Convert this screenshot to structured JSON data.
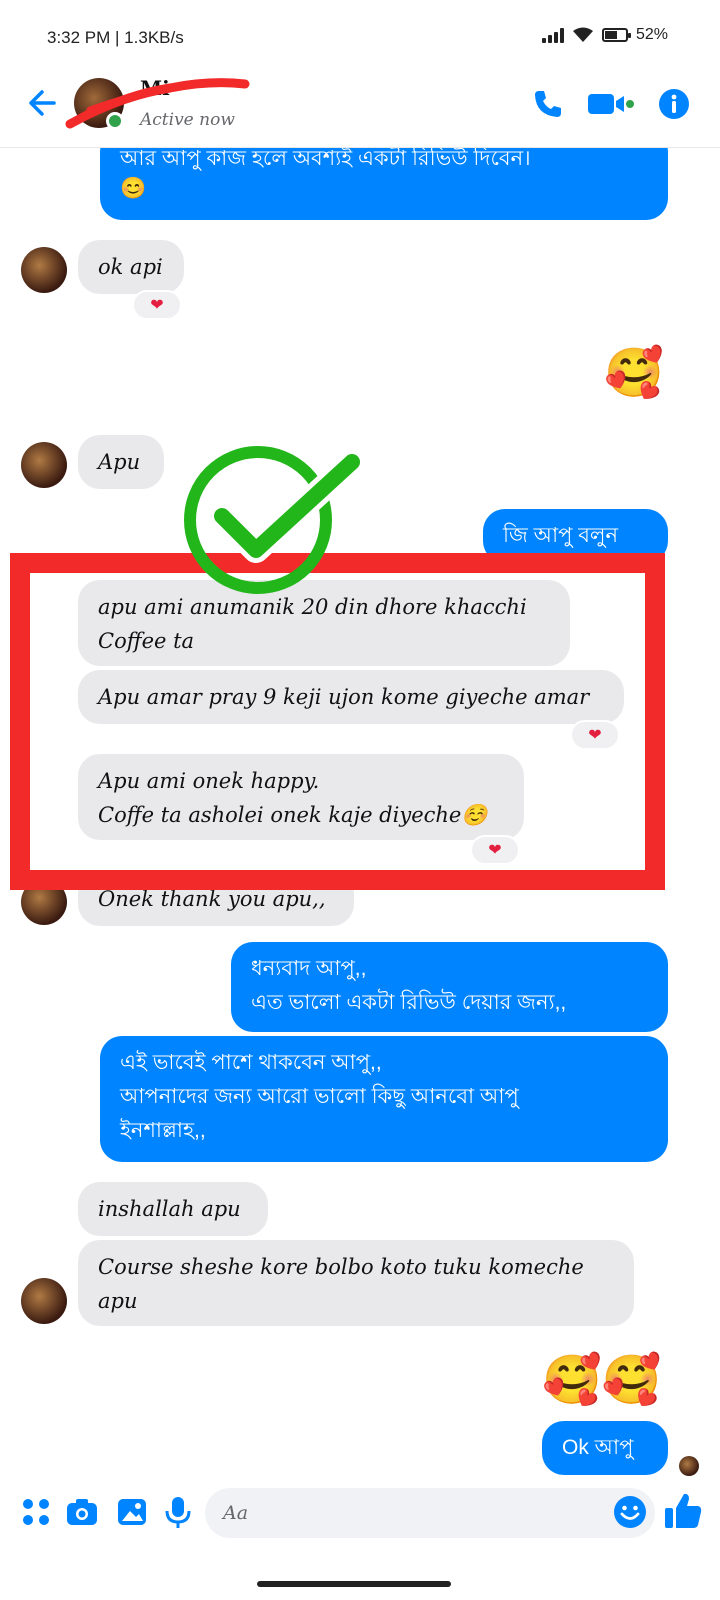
{
  "status_bar": {
    "time": "3:32 PM",
    "net_speed": "| 1.3KB/s",
    "battery": "52%"
  },
  "header": {
    "contact_name": "Mi",
    "active_status": "Active now",
    "accent_color": "#0084ff",
    "online_color": "#31a24c"
  },
  "messages": {
    "m1": {
      "line1": "আর আপু কাজ হলে অবশ্যই একটা রিভিউ দিবেন।",
      "line2": "😊"
    },
    "m2": {
      "text": "ok api",
      "reaction": "❤"
    },
    "m3": {
      "emoji": "🥰"
    },
    "m4": {
      "text": "Apu"
    },
    "m5": {
      "text": "জি আপু বলুন"
    },
    "m6": {
      "line1": "apu ami anumanik 20 din dhore khacchi",
      "line2": "Coffee ta"
    },
    "m7": {
      "text": "Apu amar pray 9 keji ujon kome giyeche amar",
      "reaction": "❤"
    },
    "m8": {
      "line1": "Apu ami onek happy.",
      "line2": "Coffe ta asholei onek kaje diyeche☺️",
      "reaction": "❤"
    },
    "m9": {
      "text": "Onek thank you apu,,"
    },
    "m10": {
      "line1": "ধন্যবাদ আপু,,",
      "line2": "এত ভালো একটা রিভিউ দেয়ার জন্য,,"
    },
    "m11": {
      "line1": "এই ভাবেই পাশে থাকবেন আপু,,",
      "line2": "আপনাদের জন্য আরো ভালো কিছু আনবো আপু",
      "line3": "ইনশাল্লাহ,,"
    },
    "m12": {
      "text": "inshallah apu"
    },
    "m13": {
      "line1": "Course sheshe kore bolbo koto tuku komeche",
      "line2": "apu"
    },
    "m14": {
      "emoji": "🥰🥰"
    },
    "m15": {
      "text": "Ok আপু"
    }
  },
  "composer": {
    "placeholder": "Aa"
  },
  "icons": {
    "header": [
      "back-arrow-icon",
      "phone-icon",
      "video-call-icon",
      "info-icon"
    ],
    "composer": [
      "menu-dots-icon",
      "camera-icon",
      "gallery-icon",
      "microphone-icon",
      "smiley-icon",
      "thumbs-up-icon"
    ]
  },
  "annotation": {
    "box_color": "#f22a2a",
    "check_color": "#22b61b"
  }
}
